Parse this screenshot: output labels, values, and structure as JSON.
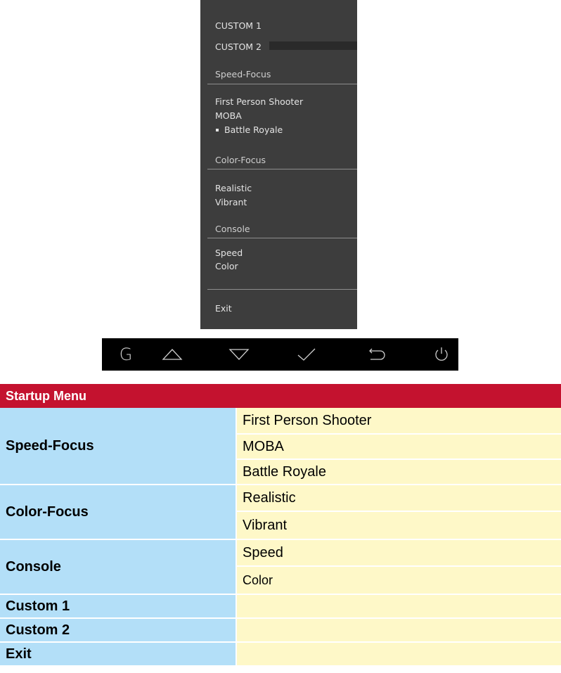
{
  "osd": {
    "custom1": "CUSTOM 1",
    "custom2": "CUSTOM 2",
    "speed_focus": {
      "header": "Speed-Focus",
      "items": [
        "First Person Shooter",
        "MOBA",
        "Battle Royale"
      ],
      "selected": "Battle Royale"
    },
    "color_focus": {
      "header": "Color-Focus",
      "items": [
        "Realistic",
        "Vibrant"
      ]
    },
    "console": {
      "header": "Console",
      "items": [
        "Speed",
        "Color"
      ]
    },
    "exit": "Exit"
  },
  "keys": [
    {
      "icon": "g-icon",
      "glyph": "G"
    },
    {
      "icon": "up-triangle-icon"
    },
    {
      "icon": "down-triangle-icon"
    },
    {
      "icon": "checkmark-icon"
    },
    {
      "icon": "return-icon"
    },
    {
      "icon": "power-icon"
    }
  ],
  "table": {
    "title": "Startup Menu",
    "groups": [
      {
        "label": "Speed-Focus",
        "items": [
          "First Person Shooter",
          "MOBA",
          "Battle Royale"
        ]
      },
      {
        "label": "Color-Focus",
        "items": [
          "Realistic",
          "Vibrant"
        ]
      },
      {
        "label": "Console",
        "items": [
          "Speed",
          "Color"
        ]
      },
      {
        "label": "Custom 1",
        "items": []
      },
      {
        "label": "Custom 2",
        "items": []
      },
      {
        "label": "Exit",
        "items": []
      }
    ]
  },
  "colors": {
    "osd_bg": "#3d3d3d",
    "key_bar_bg": "#000000",
    "table_header": "#c4122f",
    "left_cell": "#b3dff8",
    "right_cell": "#fef8c8"
  }
}
